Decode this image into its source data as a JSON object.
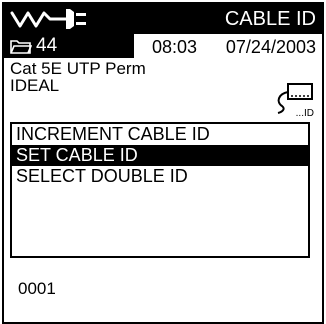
{
  "header": {
    "logo_icon": "cable-tester-logo-icon",
    "title": "CABLE ID",
    "folder_icon": "folder-icon",
    "folder_count": "44",
    "time": "08:03",
    "date": "07/24/2003"
  },
  "info": {
    "cable_type": "Cat 5E UTP Perm",
    "vendor": "IDEAL",
    "id_icon": "cable-id-icon",
    "id_icon_label": "...ID"
  },
  "menu": {
    "items": [
      {
        "label": "INCREMENT CABLE ID",
        "selected": false
      },
      {
        "label": "SET CABLE ID",
        "selected": true
      },
      {
        "label": "SELECT DOUBLE ID",
        "selected": false
      }
    ]
  },
  "current_value": "0001",
  "colors": {
    "foreground": "#000000",
    "background": "#ffffff",
    "highlight": "#000000"
  }
}
